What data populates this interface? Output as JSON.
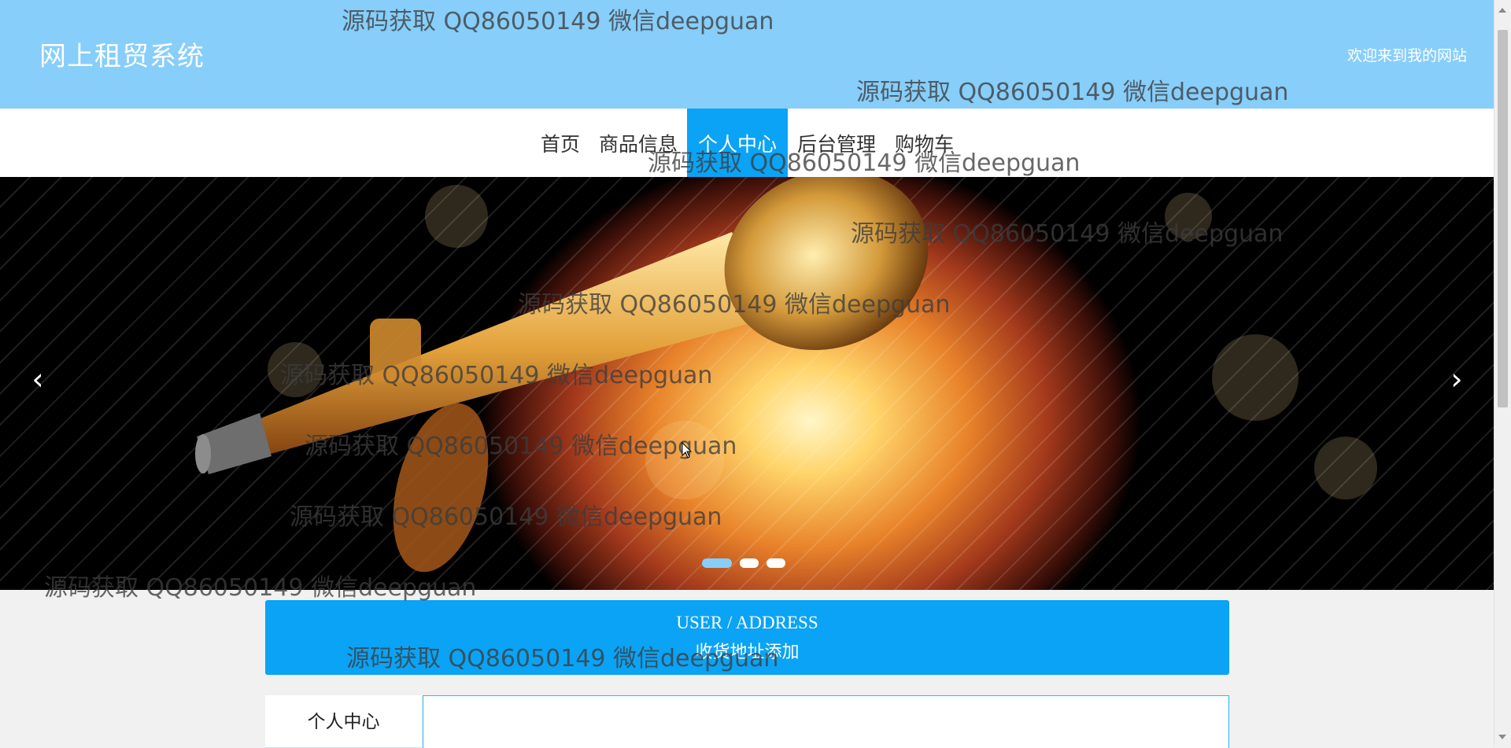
{
  "header": {
    "site_title": "网上租贸系统",
    "welcome": "欢迎来到我的网站"
  },
  "nav": {
    "items": [
      {
        "label": "首页"
      },
      {
        "label": "商品信息"
      },
      {
        "label": "个人中心",
        "active": true
      },
      {
        "label": "后台管理"
      },
      {
        "label": "购物车"
      }
    ]
  },
  "banner": {
    "prev_icon": "chevron-left-icon",
    "next_icon": "chevron-right-icon",
    "slide_count": 3,
    "active_slide": 1
  },
  "section": {
    "title_en": "USER / ADDRESS",
    "title_zh": "收货地址添加"
  },
  "sidebar": {
    "items": [
      {
        "label": "个人中心"
      }
    ]
  },
  "watermarks": [
    "源码获取 QQ86050149 微信deepguan",
    "源码获取 QQ86050149 微信deepguan",
    "源码获取 QQ86050149 微信deepguan",
    "源码获取 QQ86050149 微信deepguan",
    "源码获取 QQ86050149 微信deepguan",
    "源码获取 QQ86050149 微信deepguan",
    "源码获取 QQ86050149 微信deepguan",
    "源码获取 QQ86050149 微信deepguan",
    "源码获取 QQ86050149 微信deepguan",
    "源码获取 QQ86050149 微信deepguan"
  ],
  "colors": {
    "header_bg": "#87cefa",
    "accent": "#0ba3f5",
    "page_bg": "#f1f1f1"
  }
}
